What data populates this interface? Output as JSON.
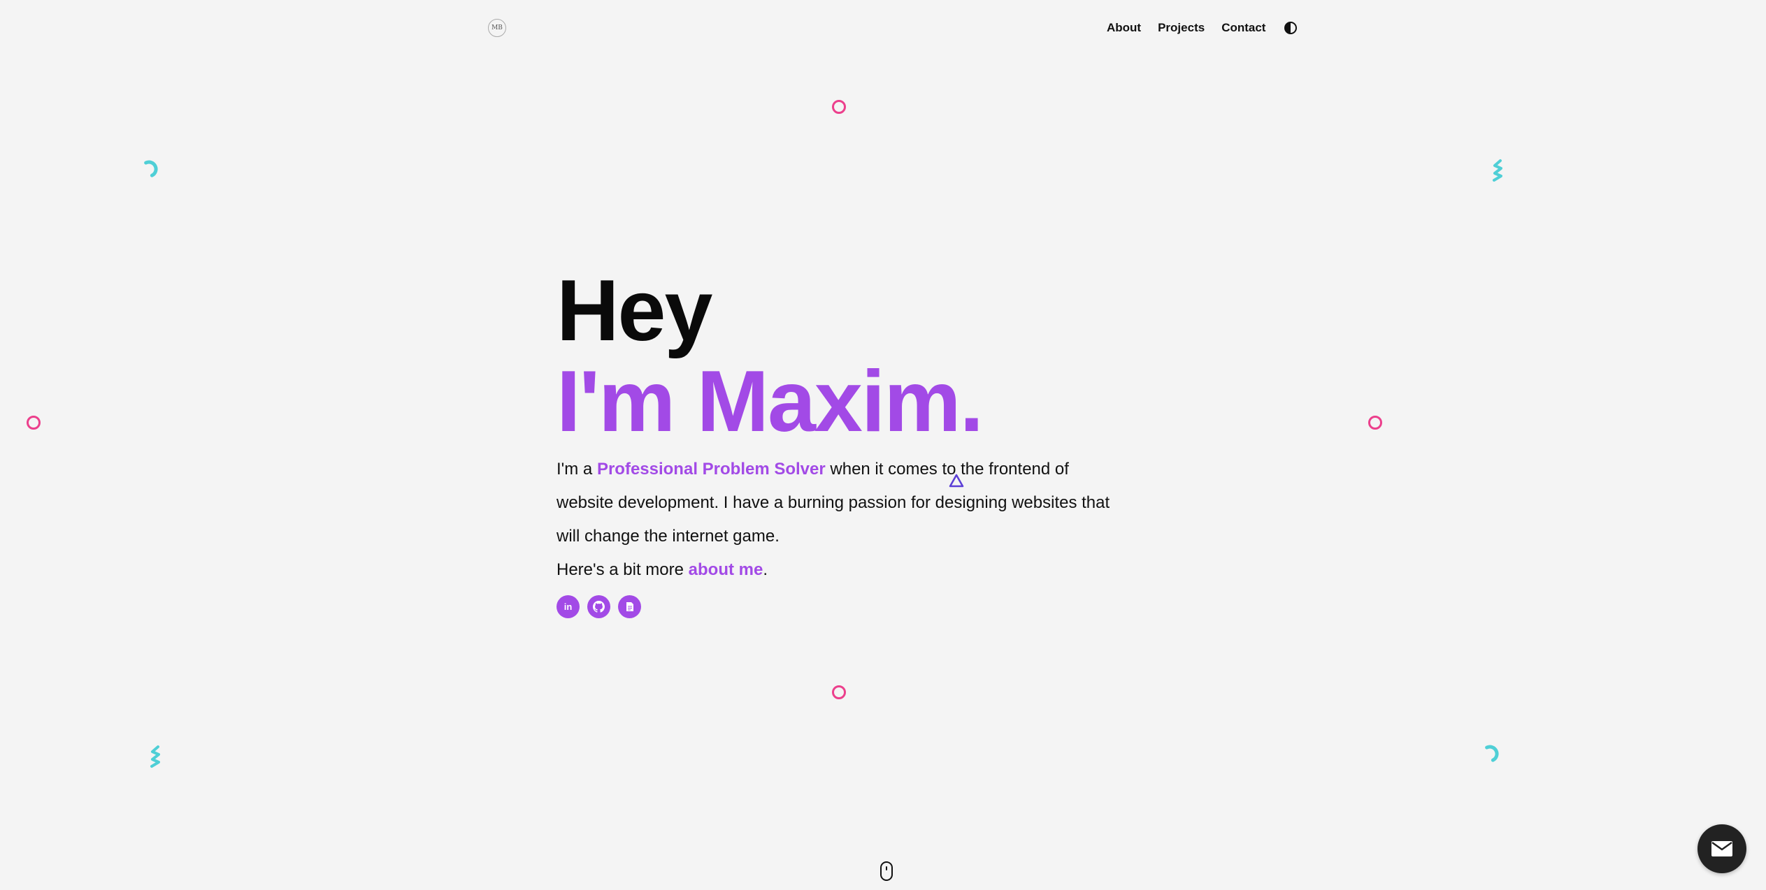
{
  "header": {
    "logo_text": "MB",
    "nav": [
      {
        "label": "About"
      },
      {
        "label": "Projects"
      },
      {
        "label": "Contact"
      }
    ],
    "theme_toggle_icon": "half-circle-icon"
  },
  "hero": {
    "greeting": "Hey",
    "name_line": "I'm Maxim.",
    "intro_prefix": "I'm a ",
    "intro_highlight": "Professional Problem Solver",
    "intro_suffix": " when it comes to the frontend of website development. I have a burning passion for designing websites that will change the internet game.",
    "more_prefix": "Here's a bit more ",
    "more_link": "about me",
    "more_suffix": "."
  },
  "socials": [
    {
      "name": "linkedin",
      "icon": "linkedin-icon",
      "glyph": "in"
    },
    {
      "name": "github",
      "icon": "github-icon"
    },
    {
      "name": "resume",
      "icon": "document-icon"
    }
  ],
  "scroll_indicator_icon": "mouse-icon",
  "contact_fab_icon": "envelope-icon",
  "colors": {
    "accent": "#a24ae6",
    "ring": "#ec3f8c",
    "teal": "#4fcfd6",
    "triangle": "#5b3fd6",
    "background": "#f4f4f4"
  }
}
